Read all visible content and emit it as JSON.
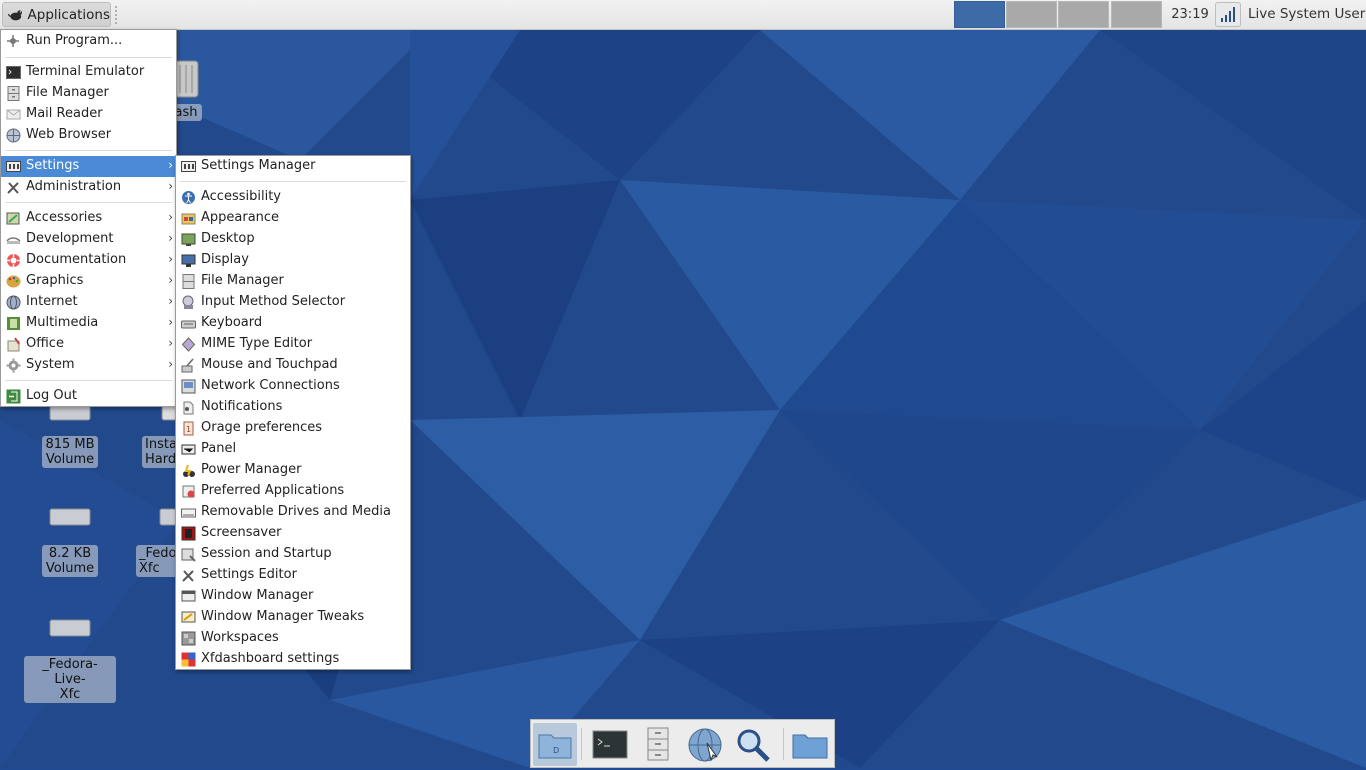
{
  "panel": {
    "applications_label": "Applications",
    "clock": "23:19",
    "user": "Live System User",
    "workspaces": [
      {
        "active": true
      },
      {
        "active": false
      },
      {
        "active": false
      },
      {
        "active": false
      }
    ]
  },
  "desktop_icons": {
    "trash": "ash",
    "vol815_line1": "815 MB",
    "vol815_line2": "Volume",
    "inst_line1": "Insta",
    "inst_line2": "Hard",
    "vol82_line1": "8.2 KB",
    "vol82_line2": "Volume",
    "fed2_line1": "_Fedo",
    "fed2_line2": "Xfc",
    "fedora_line1": "_Fedora-Live-",
    "fedora_line2": "Xfc"
  },
  "app_menu": {
    "run_program": "Run Program...",
    "terminal": "Terminal Emulator",
    "file_manager": "File Manager",
    "mail_reader": "Mail Reader",
    "web_browser": "Web Browser",
    "settings": "Settings",
    "administration": "Administration",
    "accessories": "Accessories",
    "development": "Development",
    "documentation": "Documentation",
    "graphics": "Graphics",
    "internet": "Internet",
    "multimedia": "Multimedia",
    "office": "Office",
    "system": "System",
    "log_out": "Log Out",
    "arrow": "›"
  },
  "settings_menu": {
    "settings_manager": "Settings Manager",
    "items": [
      "Accessibility",
      "Appearance",
      "Desktop",
      "Display",
      "File Manager",
      "Input Method Selector",
      "Keyboard",
      "MIME Type Editor",
      "Mouse and Touchpad",
      "Network Connections",
      "Notifications",
      "Orage preferences",
      "Panel",
      "Power Manager",
      "Preferred Applications",
      "Removable Drives and Media",
      "Screensaver",
      "Session and Startup",
      "Settings Editor",
      "Window Manager",
      "Window Manager Tweaks",
      "Workspaces",
      "Xfdashboard settings"
    ]
  },
  "colors": {
    "highlight": "#4a8ad6",
    "active_workspace": "#3d6ba8",
    "desktop_bg": "#1f4a8f"
  }
}
